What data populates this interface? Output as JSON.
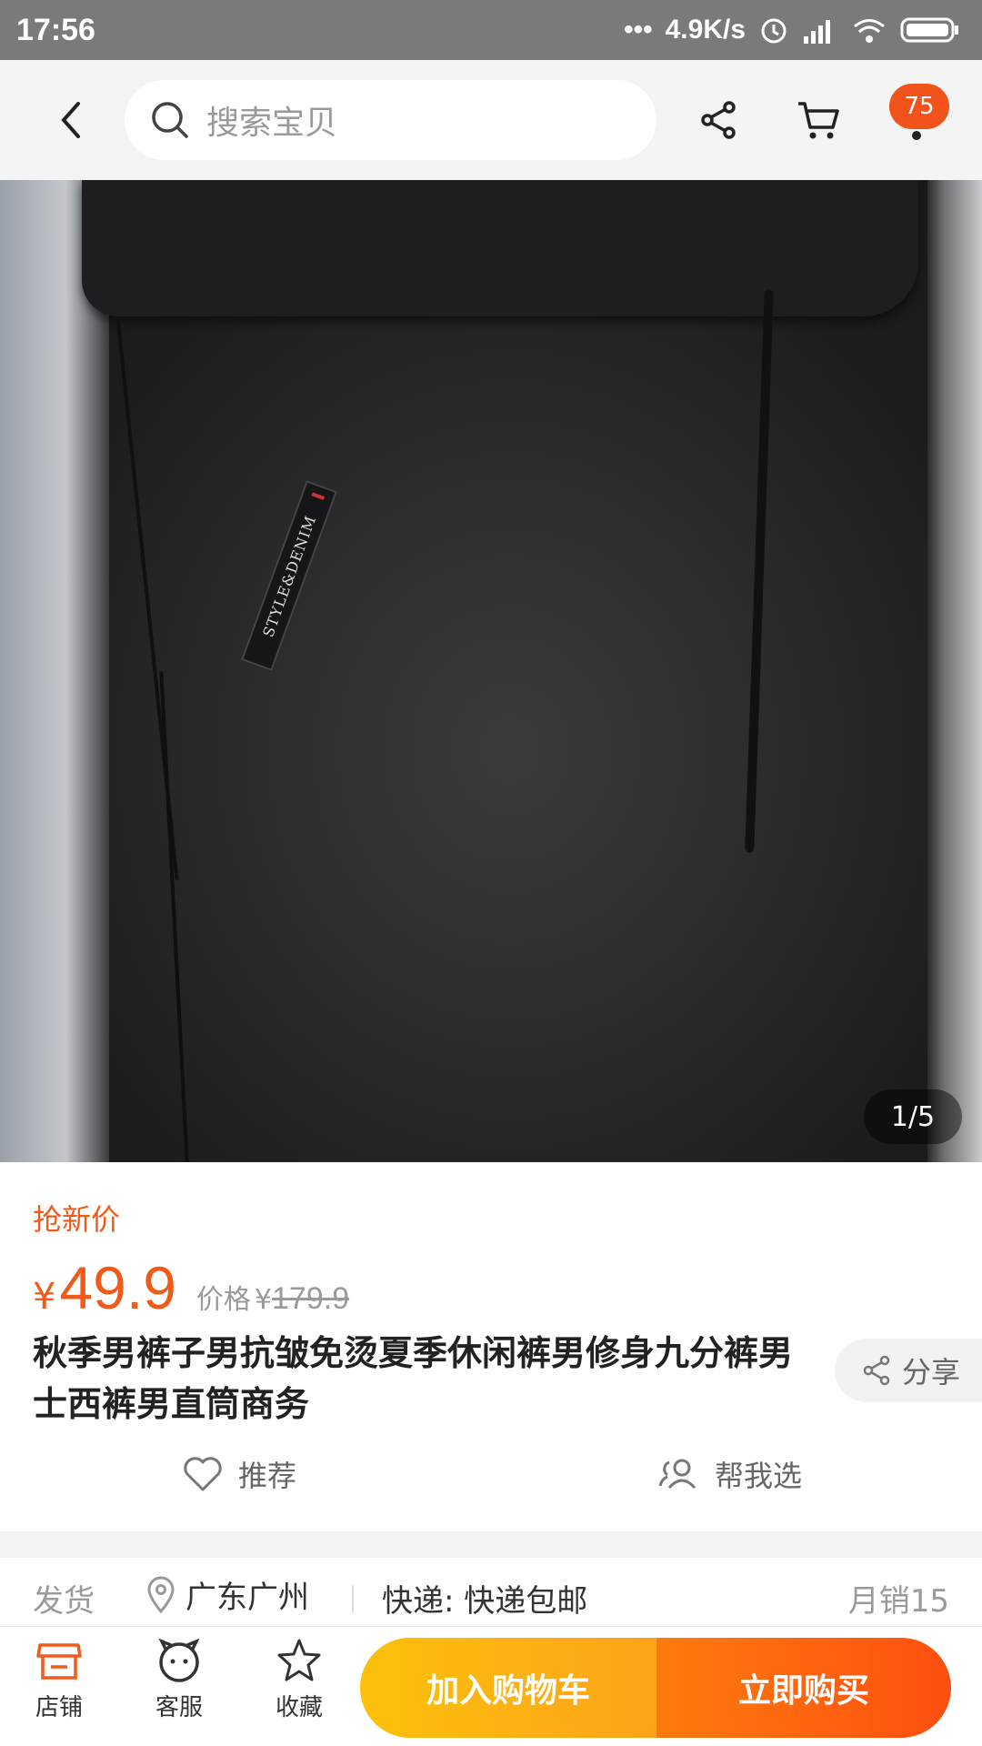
{
  "status_bar": {
    "time": "17:56",
    "network_speed": "4.9K/s"
  },
  "header": {
    "search_placeholder": "搜索宝贝",
    "cart_badge": "75"
  },
  "gallery": {
    "counter": "1/5",
    "tag_text": "STYLE&DENIM"
  },
  "product": {
    "promo_label": "抢新价",
    "currency": "¥",
    "price": "49.9",
    "original_label": "价格",
    "original_currency": "¥",
    "original_price": "179.9",
    "title": "秋季男裤子男抗皱免烫夏季休闲裤男修身九分裤男士西裤男直筒商务",
    "share_label": "分享",
    "recommend_label": "推荐",
    "help_choose_label": "帮我选"
  },
  "shipping": {
    "label": "发货",
    "location": "广东广州",
    "express": "快递: 快递包邮",
    "monthly_sales": "月销15"
  },
  "bottom_bar": {
    "store_label": "店铺",
    "service_label": "客服",
    "favorite_label": "收藏",
    "add_to_cart_label": "加入购物车",
    "buy_now_label": "立即购买"
  },
  "colors": {
    "accent_orange": "#f05a1a",
    "cart_gradient": [
      "#fcc10b",
      "#fda319"
    ],
    "buy_gradient": [
      "#fd7b0d",
      "#fe4f10"
    ]
  }
}
